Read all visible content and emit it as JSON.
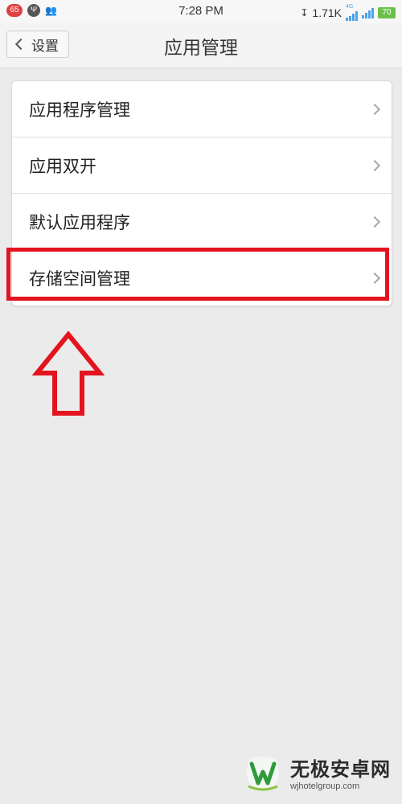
{
  "status_bar": {
    "notification_count": "65",
    "time": "7:28 PM",
    "net_speed": "1.71K",
    "network_type": "4G",
    "battery": "70"
  },
  "header": {
    "back_label": "设置",
    "title": "应用管理"
  },
  "menu": {
    "items": [
      {
        "label": "应用程序管理"
      },
      {
        "label": "应用双开"
      },
      {
        "label": "默认应用程序"
      },
      {
        "label": "存储空间管理"
      }
    ]
  },
  "highlight": {
    "color": "#e3141f",
    "target_item_index": 3
  },
  "watermark": {
    "name": "无极安卓网",
    "url": "wjhotelgroup.com"
  },
  "icons": {
    "back": "chevron-left-icon",
    "item_arrow": "chevron-right-icon",
    "annotation": "up-arrow-icon"
  }
}
